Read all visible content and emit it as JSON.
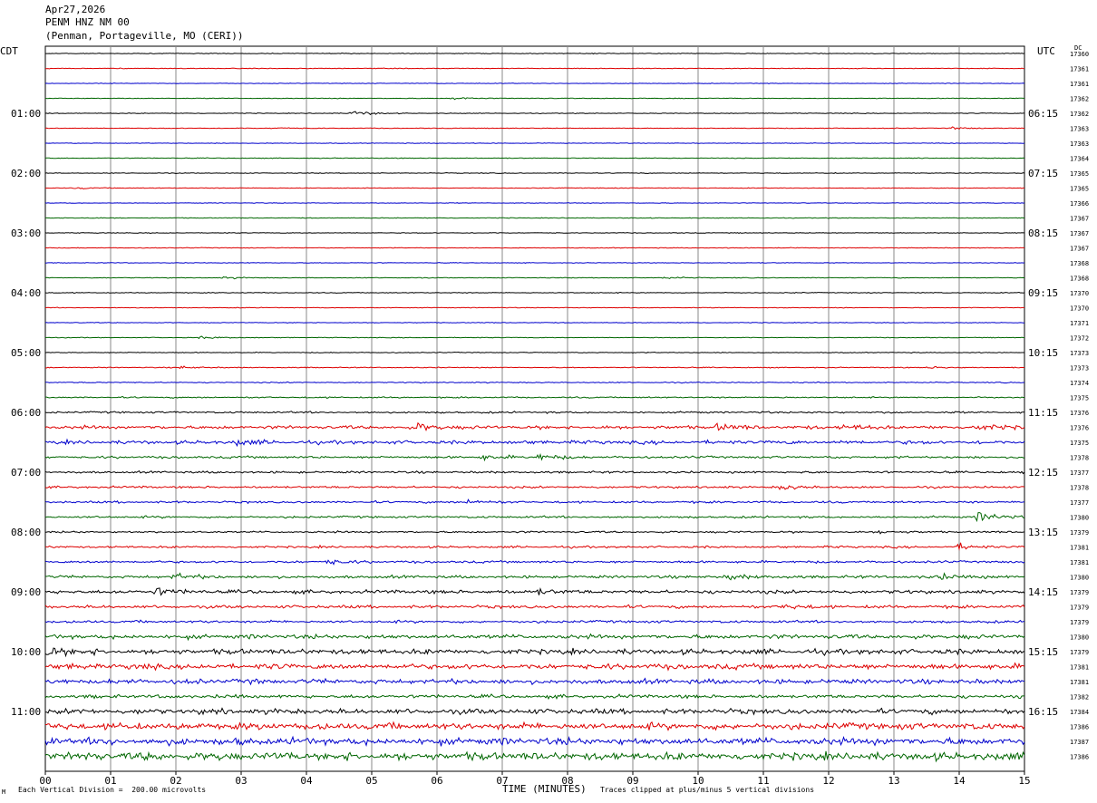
{
  "header": {
    "date": "Apr27,2026",
    "station": "PENM HNZ NM 00",
    "location": "(Penman, Portageville, MO (CERI))"
  },
  "tz": {
    "left": "CDT",
    "right": "UTC",
    "dc": "DC"
  },
  "footer": {
    "scale_note": "Each Vertical Division =  200.00 microvolts",
    "xlabel": "TIME (MINUTES)",
    "clip_note": "Traces clipped at plus/minus 5 vertical divisions",
    "corner_mark": "M"
  },
  "chart_data": {
    "type": "line",
    "title": "PENM HNZ NM 00",
    "xlabel": "TIME (MINUTES)",
    "xlim": [
      0,
      15
    ],
    "x_ticks": [
      "00",
      "01",
      "02",
      "03",
      "04",
      "05",
      "06",
      "07",
      "08",
      "09",
      "10",
      "11",
      "12",
      "13",
      "14",
      "15"
    ],
    "grid": "vertical lines every minute",
    "trace_minutes_each": 15,
    "trace_colors": [
      "#000000",
      "#dd0000",
      "#0000cc",
      "#006600"
    ],
    "left_hour_labels": [
      {
        "trace": 4,
        "label": "01:00"
      },
      {
        "trace": 8,
        "label": "02:00"
      },
      {
        "trace": 12,
        "label": "03:00"
      },
      {
        "trace": 16,
        "label": "04:00"
      },
      {
        "trace": 20,
        "label": "05:00"
      },
      {
        "trace": 24,
        "label": "06:00"
      },
      {
        "trace": 28,
        "label": "07:00"
      },
      {
        "trace": 32,
        "label": "08:00"
      },
      {
        "trace": 36,
        "label": "09:00"
      },
      {
        "trace": 40,
        "label": "10:00"
      },
      {
        "trace": 44,
        "label": "11:00"
      }
    ],
    "right_hour_labels": [
      {
        "trace": 4,
        "label": "06:15"
      },
      {
        "trace": 8,
        "label": "07:15"
      },
      {
        "trace": 12,
        "label": "08:15"
      },
      {
        "trace": 16,
        "label": "09:15"
      },
      {
        "trace": 20,
        "label": "10:15"
      },
      {
        "trace": 24,
        "label": "11:15"
      },
      {
        "trace": 28,
        "label": "12:15"
      },
      {
        "trace": 32,
        "label": "13:15"
      },
      {
        "trace": 36,
        "label": "14:15"
      },
      {
        "trace": 40,
        "label": "15:15"
      },
      {
        "trace": 44,
        "label": "16:15"
      }
    ],
    "dc_offsets": [
      "17360",
      "17361",
      "17361",
      "17362",
      "17362",
      "17363",
      "17363",
      "17364",
      "17365",
      "17365",
      "17366",
      "17367",
      "17367",
      "17367",
      "17368",
      "17368",
      "17370",
      "17370",
      "17371",
      "17372",
      "17373",
      "17373",
      "17374",
      "17375",
      "17376",
      "17376",
      "17375",
      "17378",
      "17377",
      "17378",
      "17377",
      "17380",
      "17379",
      "17381",
      "17381",
      "17380",
      "17379",
      "17379",
      "17379",
      "17380",
      "17379",
      "17381",
      "17381",
      "17382",
      "17384",
      "17386",
      "17387",
      "17386"
    ],
    "noise_level": [
      0.3,
      0.3,
      0.25,
      0.3,
      0.3,
      0.3,
      0.25,
      0.3,
      0.3,
      0.3,
      0.25,
      0.3,
      0.3,
      0.3,
      0.25,
      0.3,
      0.35,
      0.3,
      0.3,
      0.3,
      0.35,
      0.4,
      0.45,
      0.6,
      0.8,
      1.4,
      1.5,
      1.0,
      0.9,
      0.9,
      0.9,
      0.9,
      0.8,
      0.9,
      1.0,
      1.2,
      1.5,
      1.3,
      1.1,
      1.8,
      2.2,
      2.3,
      2.0,
      1.5,
      2.2,
      2.8,
      3.0,
      3.3
    ],
    "events": [
      {
        "trace": 3,
        "minute": 6.25,
        "amp": 1.2
      },
      {
        "trace": 4,
        "minute": 4.7,
        "amp": 2.8
      },
      {
        "trace": 5,
        "minute": 3.5,
        "amp": 0.8
      },
      {
        "trace": 5,
        "minute": 13.9,
        "amp": 1.0
      },
      {
        "trace": 9,
        "minute": 0.5,
        "amp": 0.8
      },
      {
        "trace": 11,
        "minute": 0.5,
        "amp": 0.6
      },
      {
        "trace": 15,
        "minute": 2.75,
        "amp": 1.0
      },
      {
        "trace": 15,
        "minute": 9.5,
        "amp": 1.0
      },
      {
        "trace": 19,
        "minute": 2.4,
        "amp": 1.2
      },
      {
        "trace": 21,
        "minute": 2.1,
        "amp": 1.3
      },
      {
        "trace": 21,
        "minute": 13.5,
        "amp": 1.0
      },
      {
        "trace": 25,
        "minute": 5.7,
        "amp": 3.5
      },
      {
        "trace": 25,
        "minute": 10.3,
        "amp": 3.0
      },
      {
        "trace": 25,
        "minute": 12.2,
        "amp": 2.6
      },
      {
        "trace": 25,
        "minute": 14.2,
        "amp": 3.2
      },
      {
        "trace": 26,
        "minute": 2.9,
        "amp": 3.0
      },
      {
        "trace": 27,
        "minute": 6.7,
        "amp": 2.4
      },
      {
        "trace": 27,
        "minute": 7.55,
        "amp": 3.0
      },
      {
        "trace": 29,
        "minute": 11.3,
        "amp": 2.5
      },
      {
        "trace": 30,
        "minute": 6.5,
        "amp": 2.2
      },
      {
        "trace": 31,
        "minute": 14.3,
        "amp": 5.0
      },
      {
        "trace": 32,
        "minute": 12.8,
        "amp": 1.5
      },
      {
        "trace": 33,
        "minute": 14.0,
        "amp": 2.5
      },
      {
        "trace": 34,
        "minute": 4.3,
        "amp": 2.5
      },
      {
        "trace": 35,
        "minute": 2.0,
        "amp": 3.0
      },
      {
        "trace": 35,
        "minute": 10.5,
        "amp": 2.5
      },
      {
        "trace": 35,
        "minute": 13.7,
        "amp": 2.5
      },
      {
        "trace": 36,
        "minute": 1.7,
        "amp": 3.5
      },
      {
        "trace": 36,
        "minute": 7.5,
        "amp": 2.5
      },
      {
        "trace": 37,
        "minute": 11.3,
        "amp": 2.5
      },
      {
        "trace": 40,
        "minute": 0.05,
        "amp": 4.5
      }
    ]
  }
}
